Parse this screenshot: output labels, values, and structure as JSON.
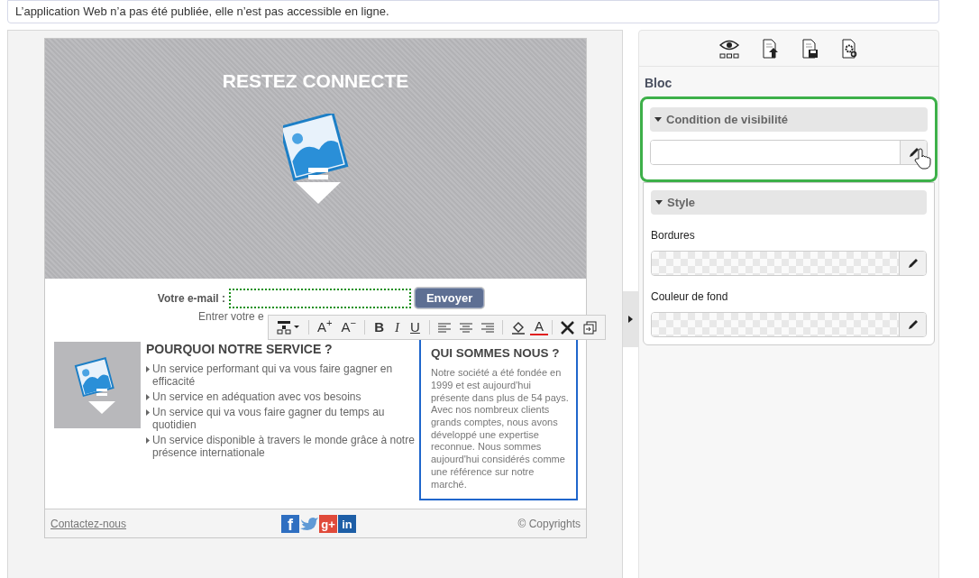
{
  "notice": "L’application Web n’a pas été publiée, elle n’est pas accessible en ligne.",
  "email_page": {
    "hero_title": "RESTEZ CONNECTE",
    "email_label": "Votre e-mail :",
    "submit_label": "Envoyer",
    "hint": "Entrer votre e",
    "features_title": "POURQUOI NOTRE SERVICE ?",
    "features": [
      "Un service performant qui va vous faire gagner en efficacité",
      "Un service en adéquation avec vos besoins",
      "Un service qui va vous faire gagner du temps au quotidien",
      "Un service disponible à travers le monde grâce à notre présence internationale"
    ],
    "about_title": "QUI SOMMES NOUS ?",
    "about_text": "Notre société a été fondée en 1999 et est aujourd'hui présente dans plus de 54 pays. Avec nos nombreux clients grands comptes, nous avons développé une expertise reconnue. Nous sommes aujourd'hui considérés comme une référence sur notre marché.",
    "footer": {
      "contact": "Contactez-nous",
      "copyright": "© Copyrights",
      "social": [
        {
          "kind": "facebook",
          "glyph": "f"
        },
        {
          "kind": "twitter"
        },
        {
          "kind": "googleplus",
          "glyph": "g+"
        },
        {
          "kind": "linkedin",
          "glyph": "in"
        }
      ]
    }
  },
  "format_toolbar": [
    {
      "kind": "insert_block"
    },
    {
      "kind": "sep"
    },
    {
      "kind": "text",
      "glyph": "A",
      "sup": "+"
    },
    {
      "kind": "text",
      "glyph": "A",
      "sup": "−"
    },
    {
      "kind": "sep"
    },
    {
      "kind": "bold",
      "glyph": "B"
    },
    {
      "kind": "italic",
      "glyph": "I"
    },
    {
      "kind": "underline",
      "glyph": "U"
    },
    {
      "kind": "sep"
    },
    {
      "kind": "align_left"
    },
    {
      "kind": "align_center"
    },
    {
      "kind": "align_right"
    },
    {
      "kind": "sep"
    },
    {
      "kind": "fill_color"
    },
    {
      "kind": "text_color",
      "glyph": "A"
    },
    {
      "kind": "sep"
    },
    {
      "kind": "delete"
    },
    {
      "kind": "copy"
    }
  ],
  "panel": {
    "title": "Bloc",
    "sections": [
      {
        "title": "Condition de visibilité",
        "expanded": true,
        "highlighted": true,
        "fields": [
          {
            "kind": "text"
          }
        ]
      },
      {
        "title": "Style",
        "expanded": true,
        "highlighted": false,
        "fields": [
          {
            "kind": "color",
            "label": "Bordures"
          },
          {
            "kind": "color",
            "label": "Couleur de fond"
          }
        ]
      }
    ]
  }
}
